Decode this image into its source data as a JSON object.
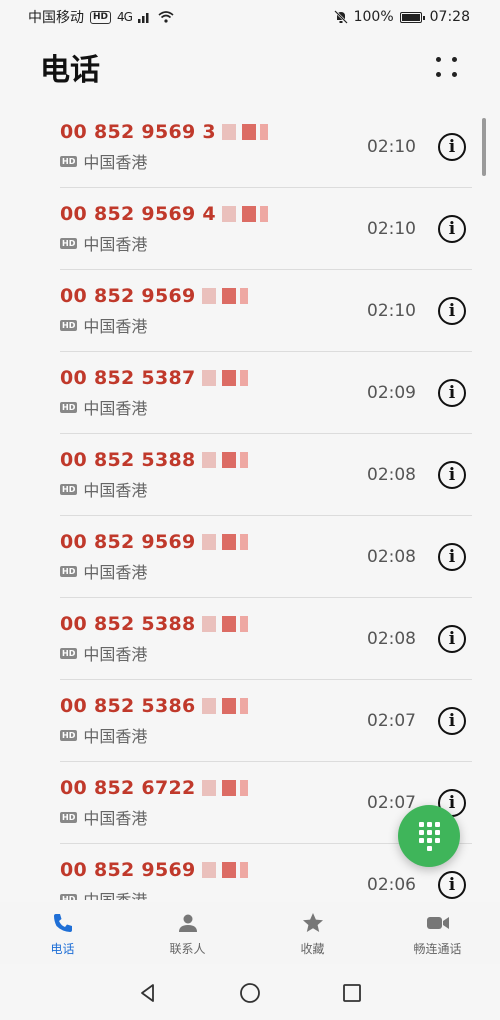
{
  "status_bar": {
    "carrier": "中国移动",
    "hd": "HD",
    "network": "4G",
    "battery": "100%",
    "time": "07:28"
  },
  "header": {
    "title": "电话"
  },
  "calls": [
    {
      "number": "00 852 9569 3",
      "location": "中国香港",
      "time": "02:10"
    },
    {
      "number": "00 852 9569 4",
      "location": "中国香港",
      "time": "02:10"
    },
    {
      "number": "00 852 9569",
      "location": "中国香港",
      "time": "02:10"
    },
    {
      "number": "00 852 5387",
      "location": "中国香港",
      "time": "02:09"
    },
    {
      "number": "00 852 5388",
      "location": "中国香港",
      "time": "02:08"
    },
    {
      "number": "00 852 9569",
      "location": "中国香港",
      "time": "02:08"
    },
    {
      "number": "00 852 5388",
      "location": "中国香港",
      "time": "02:08"
    },
    {
      "number": "00 852 5386",
      "location": "中国香港",
      "time": "02:07"
    },
    {
      "number": "00 852 6722",
      "location": "中国香港",
      "time": "02:07"
    },
    {
      "number": "00 852 9569",
      "location": "中国香港",
      "time": "02:06"
    }
  ],
  "tabs": [
    {
      "label": "电话",
      "icon": "phone-icon",
      "active": true
    },
    {
      "label": "联系人",
      "icon": "contacts-icon",
      "active": false
    },
    {
      "label": "收藏",
      "icon": "star-icon",
      "active": false
    },
    {
      "label": "畅连通话",
      "icon": "video-call-icon",
      "active": false
    }
  ],
  "colors": {
    "number_red": "#c0392b",
    "accent_blue": "#1f6fd6",
    "fab_green": "#3fb55a"
  }
}
